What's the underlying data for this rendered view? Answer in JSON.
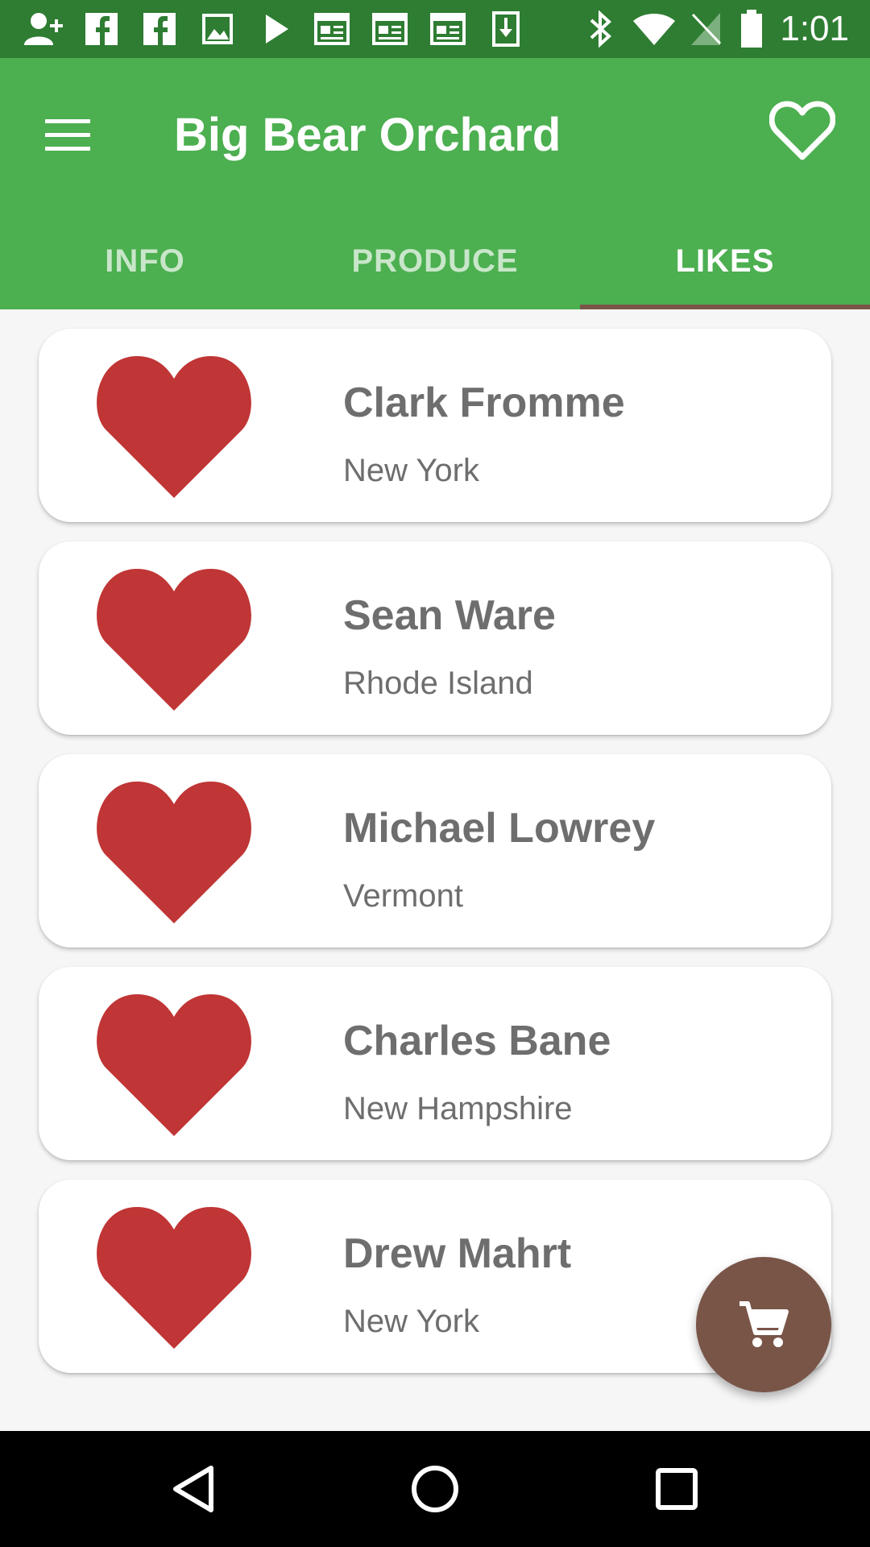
{
  "status_bar": {
    "time": "1:01",
    "icons": [
      "add-contact-icon",
      "facebook-icon",
      "facebook-icon",
      "image-icon",
      "play-store-icon",
      "news-icon",
      "news-icon",
      "news-icon",
      "download-icon",
      "bluetooth-icon",
      "wifi-icon",
      "no-signal-icon",
      "battery-icon"
    ]
  },
  "app_bar": {
    "title": "Big Bear Orchard",
    "menu_icon": "menu-icon",
    "favorite_icon": "heart-outline-icon"
  },
  "tabs": [
    {
      "label": "INFO",
      "active": false
    },
    {
      "label": "PRODUCE",
      "active": false
    },
    {
      "label": "LIKES",
      "active": true
    }
  ],
  "likes": [
    {
      "name": "Clark Fromme",
      "location": "New York"
    },
    {
      "name": "Sean Ware",
      "location": "Rhode Island"
    },
    {
      "name": "Michael Lowrey",
      "location": "Vermont"
    },
    {
      "name": "Charles Bane",
      "location": "New Hampshire"
    },
    {
      "name": "Drew Mahrt",
      "location": "New York"
    }
  ],
  "fab": {
    "icon": "cart-icon"
  },
  "nav": {
    "back_icon": "back-icon",
    "home_icon": "home-icon",
    "recents_icon": "recents-icon"
  },
  "colors": {
    "primary": "#4caf50",
    "primary_dark": "#2e7d32",
    "accent": "#795548",
    "heart": "#c03535"
  }
}
